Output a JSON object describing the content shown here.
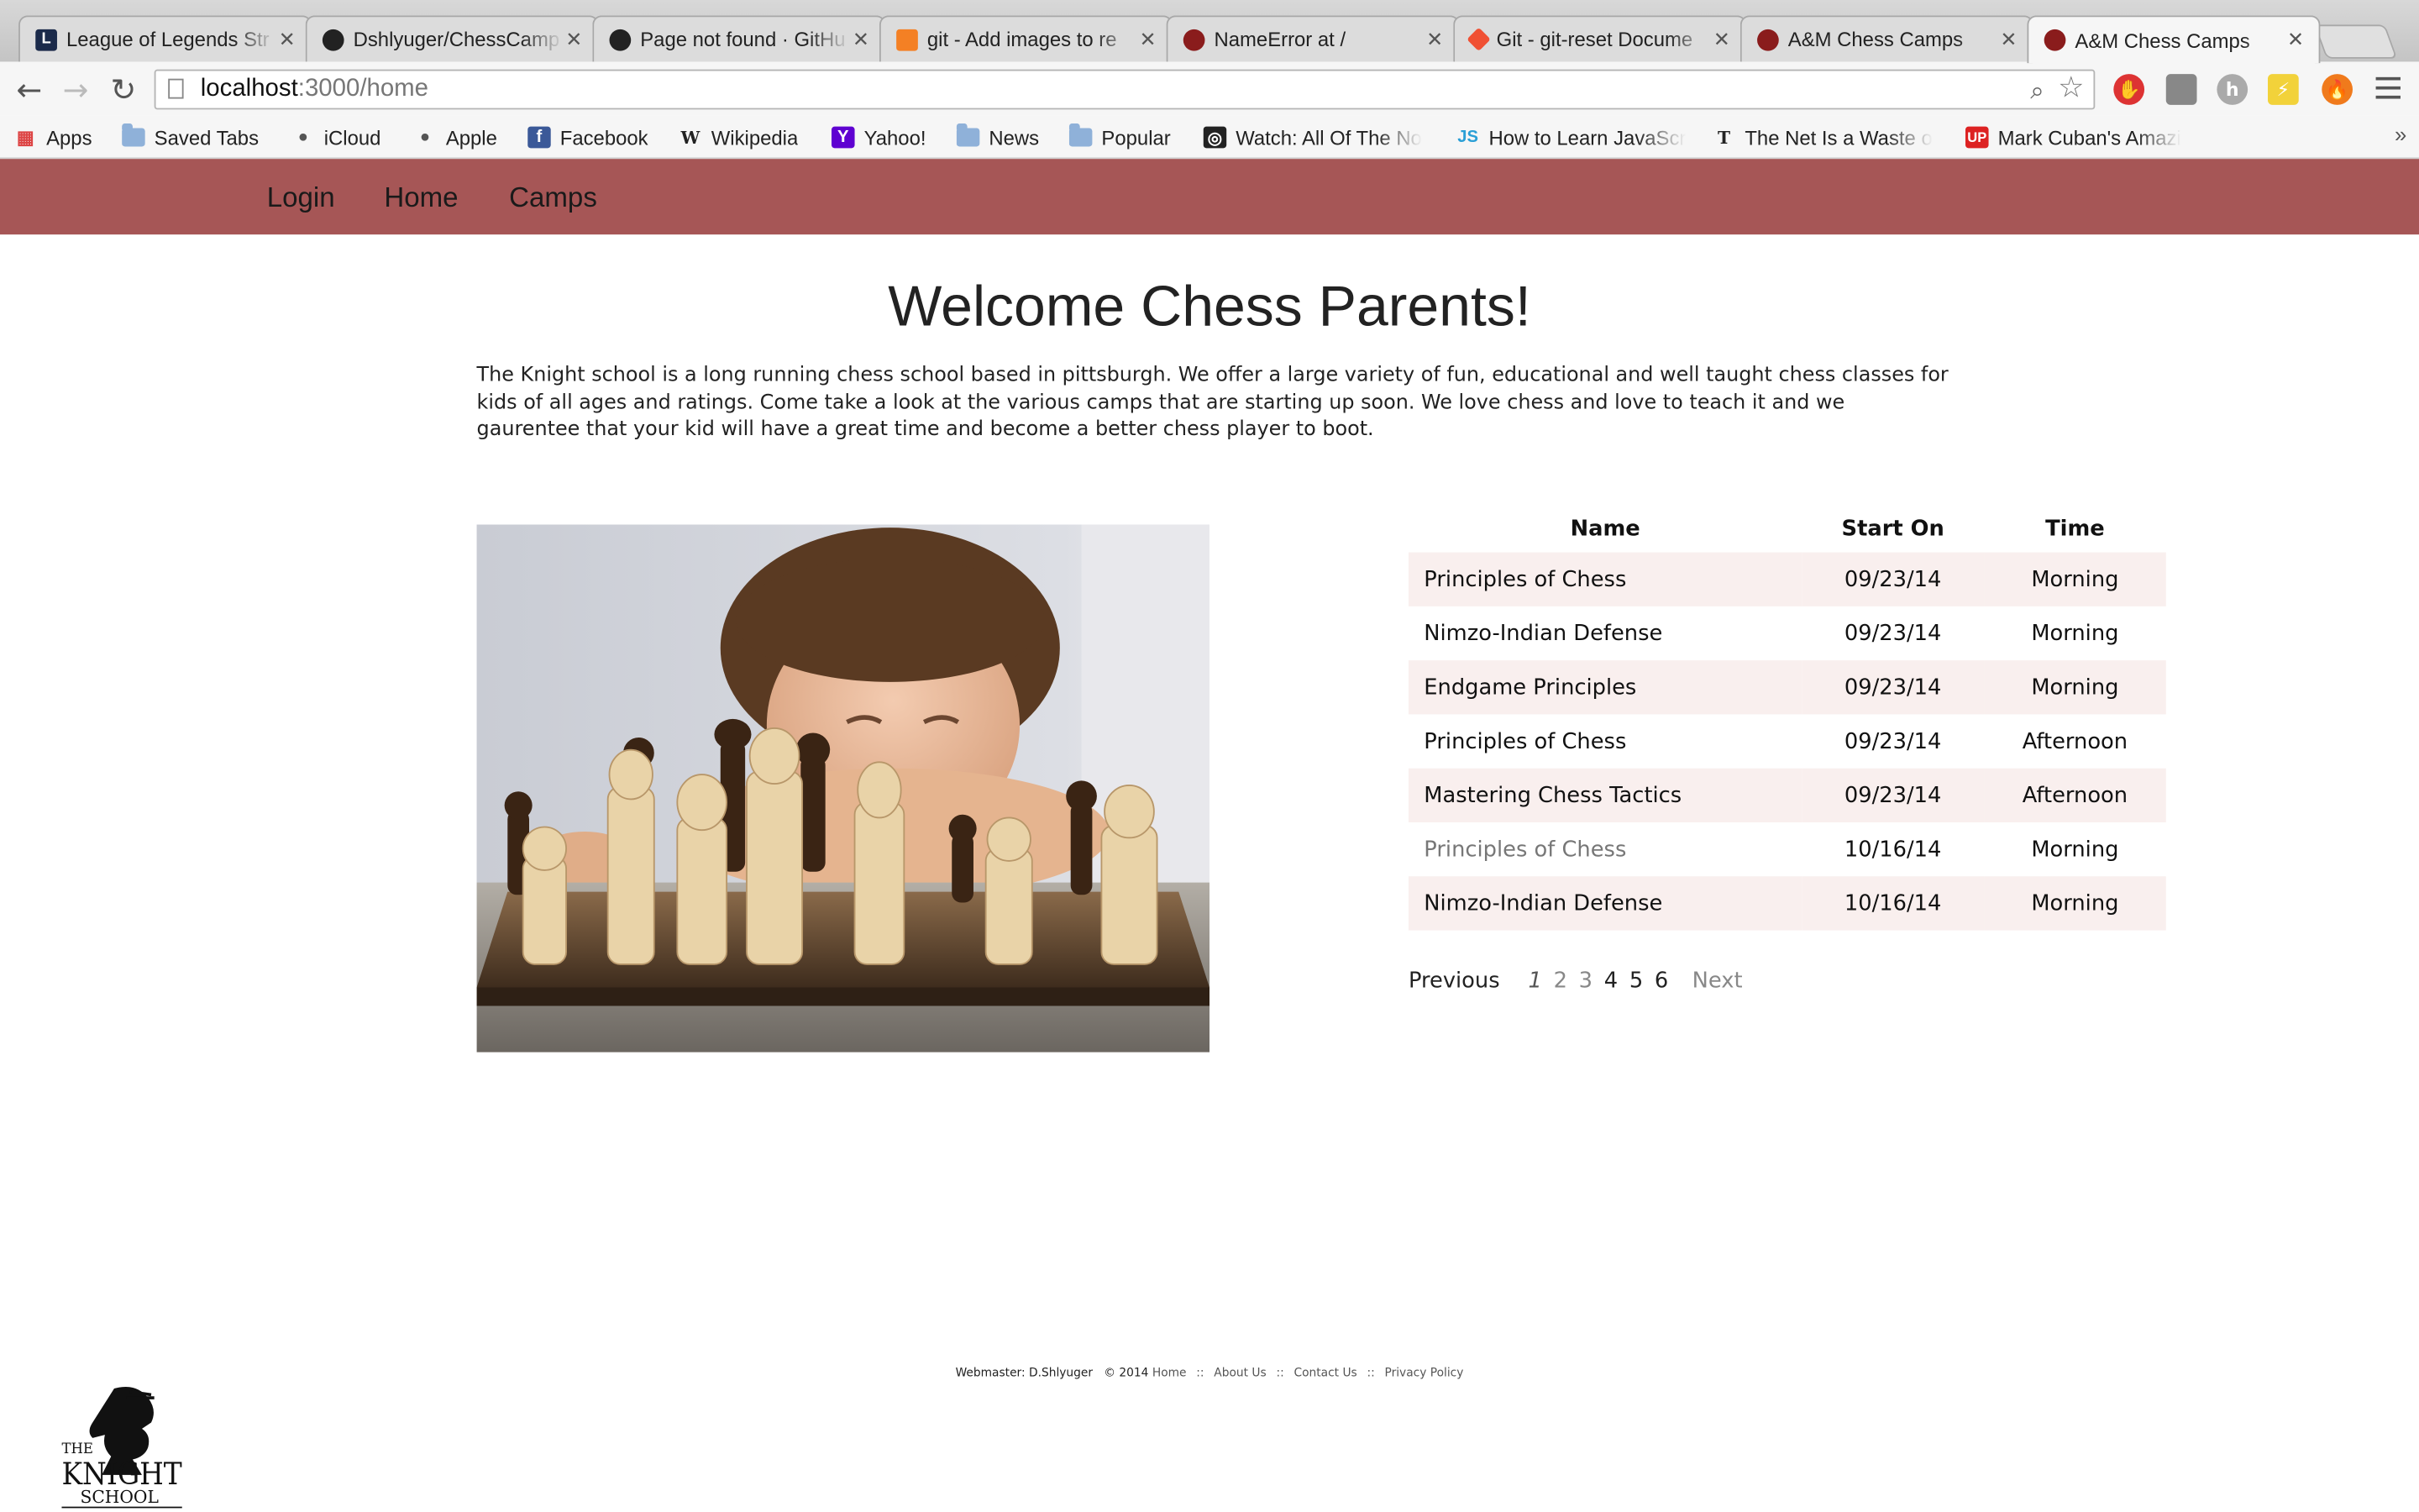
{
  "browser": {
    "tabs": [
      {
        "title": "League of Legends Str",
        "favicon_color": "#1b2a4a",
        "favicon_glyph": "L",
        "active": false
      },
      {
        "title": "Dshlyuger/ChessCamp",
        "favicon_color": "#222222",
        "favicon_glyph": "gh",
        "active": false
      },
      {
        "title": "Page not found · GitHu",
        "favicon_color": "#222222",
        "favicon_glyph": "gh",
        "active": false
      },
      {
        "title": "git - Add images to re",
        "favicon_color": "#f48024",
        "favicon_glyph": "so",
        "active": false
      },
      {
        "title": "NameError at /",
        "favicon_color": "#8a1c1c",
        "favicon_glyph": "rb",
        "active": false
      },
      {
        "title": "Git - git-reset Docume",
        "favicon_color": "#f05033",
        "favicon_glyph": "git",
        "active": false
      },
      {
        "title": "A&M Chess Camps",
        "favicon_color": "#8a1c1c",
        "favicon_glyph": "rb",
        "active": false
      },
      {
        "title": "A&M Chess Camps",
        "favicon_color": "#8a1c1c",
        "favicon_glyph": "rb",
        "active": true
      }
    ],
    "url_host": "localhost",
    "url_path": ":3000/home",
    "bookmarks": [
      {
        "label": "Apps",
        "icon": "apps-grid-icon"
      },
      {
        "label": "Saved Tabs",
        "icon": "folder-icon"
      },
      {
        "label": "iCloud",
        "icon": "apple-icon"
      },
      {
        "label": "Apple",
        "icon": "apple-icon"
      },
      {
        "label": "Facebook",
        "icon": "facebook-icon"
      },
      {
        "label": "Wikipedia",
        "icon": "wikipedia-icon"
      },
      {
        "label": "Yahoo!",
        "icon": "yahoo-icon"
      },
      {
        "label": "News",
        "icon": "folder-icon"
      },
      {
        "label": "Popular",
        "icon": "folder-icon"
      },
      {
        "label": "Watch: All Of The No",
        "icon": "watch-icon"
      },
      {
        "label": "How to Learn JavaScr",
        "icon": "js-icon"
      },
      {
        "label": "The Net Is a Waste o",
        "icon": "nyt-icon"
      },
      {
        "label": "Mark Cuban's Amazi",
        "icon": "upworthy-icon"
      }
    ]
  },
  "site": {
    "nav": [
      "Login",
      "Home",
      "Camps"
    ],
    "nav_bg": "#a65656",
    "heading": "Welcome Chess Parents!",
    "intro": "The Knight school is a long running chess school based in pittsburgh. We offer a large variety of fun, educational and well taught chess classes for kids of all ages and ratings. Come take a look at the various camps that are starting up soon. We love chess and love to teach it and we gaurentee that your kid will have a great time and become a better chess player to boot.",
    "table": {
      "headers": {
        "name": "Name",
        "start": "Start On",
        "time": "Time"
      },
      "rows": [
        {
          "name": "Principles of Chess",
          "start": "09/23/14",
          "time": "Morning"
        },
        {
          "name": "Nimzo-Indian Defense",
          "start": "09/23/14",
          "time": "Morning"
        },
        {
          "name": "Endgame Principles",
          "start": "09/23/14",
          "time": "Morning"
        },
        {
          "name": "Principles of Chess",
          "start": "09/23/14",
          "time": "Afternoon"
        },
        {
          "name": "Mastering Chess Tactics",
          "start": "09/23/14",
          "time": "Afternoon"
        },
        {
          "name": "Principles of Chess",
          "start": "10/16/14",
          "time": "Morning"
        },
        {
          "name": "Nimzo-Indian Defense",
          "start": "10/16/14",
          "time": "Morning"
        }
      ],
      "row_stripe": "#f9efee"
    },
    "pagination": {
      "previous": "Previous",
      "pages": [
        "1",
        "2",
        "3",
        "4",
        "5",
        "6"
      ],
      "current": "1",
      "next": "Next"
    },
    "footer": {
      "webmaster": "Webmaster: D.Shlyuger",
      "copyright": "© 2014",
      "links": [
        "Home",
        "About Us",
        "Contact Us",
        "Privacy Policy"
      ],
      "separator": "::"
    },
    "logo_text": [
      "THE",
      "KNIGHT",
      "SCHOOL"
    ]
  }
}
